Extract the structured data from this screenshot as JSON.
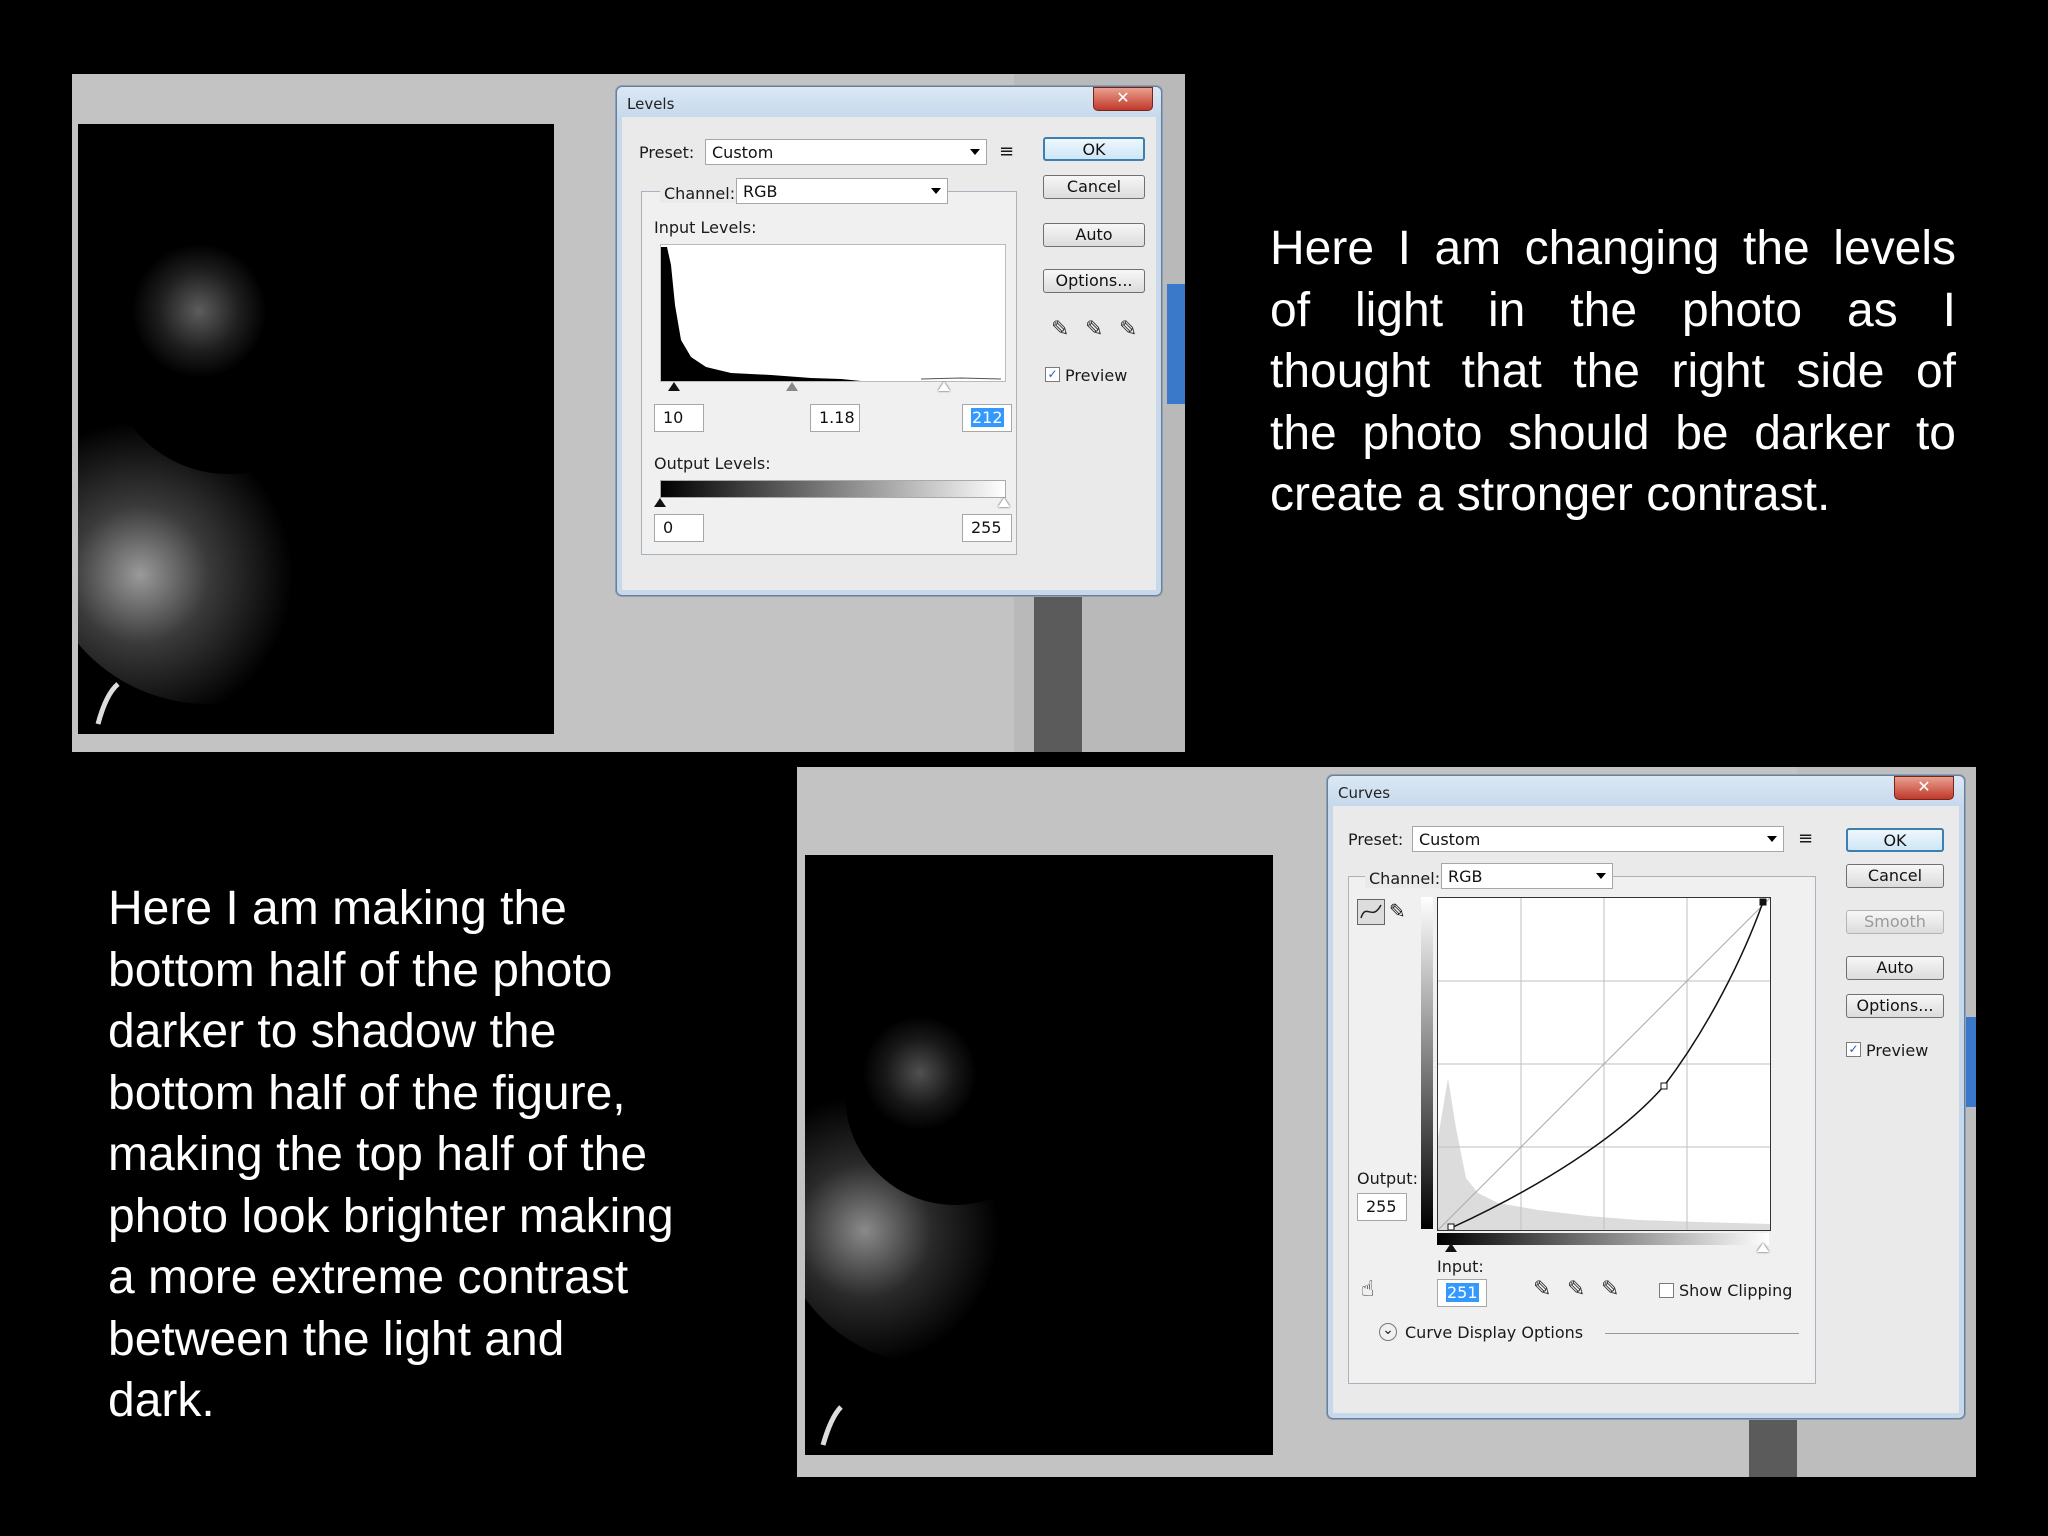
{
  "levels_dialog": {
    "title": "Levels",
    "close_glyph": "✕",
    "preset_label": "Preset:",
    "preset_value": "Custom",
    "channel_label": "Channel:",
    "channel_value": "RGB",
    "input_levels_label": "Input Levels:",
    "input_black": "10",
    "input_gamma": "1.18",
    "input_white": "212",
    "output_levels_label": "Output Levels:",
    "output_black": "0",
    "output_white": "255",
    "buttons": {
      "ok": "OK",
      "cancel": "Cancel",
      "auto": "Auto",
      "options": "Options..."
    },
    "preview_label": "Preview",
    "preview_checked": true
  },
  "curves_dialog": {
    "title": "Curves",
    "close_glyph": "✕",
    "preset_label": "Preset:",
    "preset_value": "Custom",
    "channel_label": "Channel:",
    "channel_value": "RGB",
    "output_label": "Output:",
    "output_value": "255",
    "input_label": "Input:",
    "input_value": "251",
    "show_clipping_label": "Show Clipping",
    "curve_display_options_label": "Curve Display Options",
    "buttons": {
      "ok": "OK",
      "cancel": "Cancel",
      "smooth": "Smooth",
      "auto": "Auto",
      "options": "Options..."
    },
    "preview_label": "Preview",
    "preview_checked": true
  },
  "captions": {
    "levels_lines": [
      "Here I am changing the levels",
      "of light in the photo as I",
      "thought that the right side of",
      "the photo should be darker to",
      "create a stronger contrast."
    ],
    "curves_lines": [
      "Here I am making the",
      "bottom half of the photo",
      "darker to shadow the",
      "bottom half of the figure,",
      "making the top half of the",
      "photo look brighter making",
      "a more extreme contrast",
      "between the light and",
      "dark."
    ]
  },
  "icons": {
    "checkmark": "✓",
    "eyedropper": "✎",
    "expand": "⌄",
    "hand_tool": "☝",
    "preset_menu": "≡"
  }
}
